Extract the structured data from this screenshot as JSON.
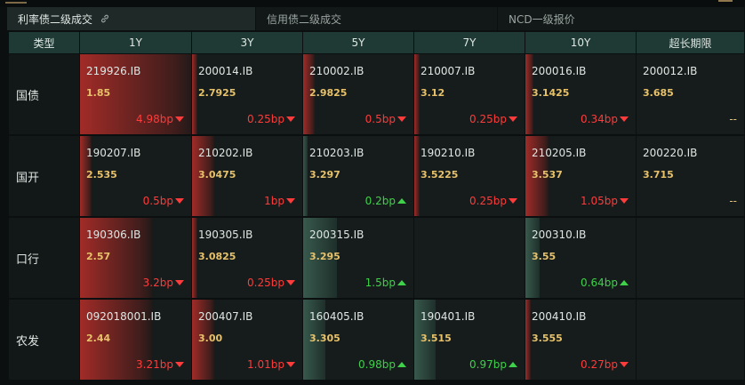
{
  "tabs": [
    {
      "label": "利率债二级成交",
      "active": true
    },
    {
      "label": "信用债二级成交",
      "active": false
    },
    {
      "label": "NCD一级报价",
      "active": false
    }
  ],
  "header": {
    "type_label": "类型",
    "terms": [
      "1Y",
      "3Y",
      "5Y",
      "7Y",
      "10Y",
      "超长期限"
    ]
  },
  "rows": [
    {
      "label": "国债",
      "cells": [
        {
          "code": "219926.IB",
          "yield": "1.85",
          "change": "4.98bp",
          "dir": "dn",
          "level": 1.0
        },
        {
          "code": "200014.IB",
          "yield": "2.7925",
          "change": "0.25bp",
          "dir": "dn",
          "level": 0.05
        },
        {
          "code": "210002.IB",
          "yield": "2.9825",
          "change": "0.5bp",
          "dir": "dn",
          "level": 0.1
        },
        {
          "code": "210007.IB",
          "yield": "3.12",
          "change": "0.25bp",
          "dir": "dn",
          "level": 0.05
        },
        {
          "code": "200016.IB",
          "yield": "3.1425",
          "change": "0.34bp",
          "dir": "dn",
          "level": 0.07
        },
        {
          "code": "200012.IB",
          "yield": "3.685",
          "change": "--",
          "dir": "flat",
          "level": 0
        }
      ]
    },
    {
      "label": "国开",
      "cells": [
        {
          "code": "190207.IB",
          "yield": "2.535",
          "change": "0.5bp",
          "dir": "dn",
          "level": 0.1
        },
        {
          "code": "210202.IB",
          "yield": "3.0475",
          "change": "1bp",
          "dir": "dn",
          "level": 0.2
        },
        {
          "code": "210203.IB",
          "yield": "3.297",
          "change": "0.2bp",
          "dir": "up",
          "level": 0.04
        },
        {
          "code": "190210.IB",
          "yield": "3.5225",
          "change": "0.25bp",
          "dir": "dn",
          "level": 0.05
        },
        {
          "code": "210205.IB",
          "yield": "3.537",
          "change": "1.05bp",
          "dir": "dn",
          "level": 0.21
        },
        {
          "code": "200220.IB",
          "yield": "3.715",
          "change": "--",
          "dir": "flat",
          "level": 0
        }
      ]
    },
    {
      "label": "口行",
      "cells": [
        {
          "code": "190306.IB",
          "yield": "2.57",
          "change": "3.2bp",
          "dir": "dn",
          "level": 0.64
        },
        {
          "code": "190305.IB",
          "yield": "3.0825",
          "change": "0.25bp",
          "dir": "dn",
          "level": 0.05
        },
        {
          "code": "200315.IB",
          "yield": "3.295",
          "change": "1.5bp",
          "dir": "up",
          "level": 0.3
        },
        {
          "code": "",
          "yield": "",
          "change": "",
          "dir": "",
          "level": 0
        },
        {
          "code": "200310.IB",
          "yield": "3.55",
          "change": "0.64bp",
          "dir": "up",
          "level": 0.13
        },
        {
          "code": "",
          "yield": "",
          "change": "",
          "dir": "",
          "level": 0
        }
      ]
    },
    {
      "label": "农发",
      "cells": [
        {
          "code": "092018001.IB",
          "yield": "2.44",
          "change": "3.21bp",
          "dir": "dn",
          "level": 0.64
        },
        {
          "code": "200407.IB",
          "yield": "3.00",
          "change": "1.01bp",
          "dir": "dn",
          "level": 0.2
        },
        {
          "code": "160405.IB",
          "yield": "3.305",
          "change": "0.98bp",
          "dir": "up",
          "level": 0.2
        },
        {
          "code": "190401.IB",
          "yield": "3.515",
          "change": "0.97bp",
          "dir": "up",
          "level": 0.19
        },
        {
          "code": "200410.IB",
          "yield": "3.555",
          "change": "0.27bp",
          "dir": "dn",
          "level": 0.05
        },
        {
          "code": "",
          "yield": "",
          "change": "",
          "dir": "",
          "level": 0
        }
      ]
    }
  ],
  "colors": {
    "down": "#ff3b3b",
    "up": "#3fd14a",
    "yield": "#e8c26a",
    "header_bg": "#1f3a34"
  },
  "icons": {
    "tab_link": "link-icon",
    "down_arrow": "triangle-down-icon",
    "up_arrow": "triangle-up-icon"
  }
}
